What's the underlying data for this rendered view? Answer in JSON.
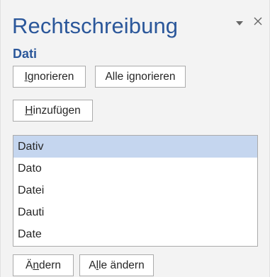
{
  "pane": {
    "title": "Rechtschreibung"
  },
  "misspelled_word": "Dati",
  "buttons": {
    "ignore": {
      "accel": "I",
      "rest": "gnorieren"
    },
    "ignore_all": {
      "before": "Alle i",
      "accel": "g",
      "after": "norieren"
    },
    "add": {
      "accel": "H",
      "rest": "inzufügen"
    },
    "change": {
      "before": "Ä",
      "accel": "n",
      "after": "dern"
    },
    "change_all": {
      "before": "A",
      "accel": "l",
      "after": "le ändern"
    }
  },
  "suggestions": [
    {
      "text": "Dativ",
      "selected": true
    },
    {
      "text": "Dato",
      "selected": false
    },
    {
      "text": "Datei",
      "selected": false
    },
    {
      "text": "Dauti",
      "selected": false
    },
    {
      "text": "Date",
      "selected": false
    }
  ],
  "icons": {
    "options": "chevron-down-icon",
    "close": "close-icon"
  },
  "colors": {
    "accent": "#2b579a",
    "selection": "#c5d6ef",
    "pane_background": "#f3f3f3"
  }
}
